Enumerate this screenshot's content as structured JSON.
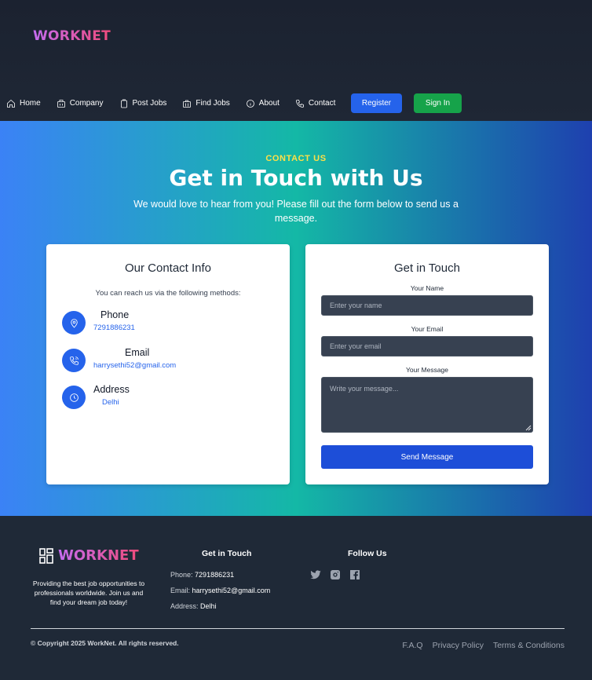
{
  "brand": {
    "name": "WORKNET",
    "gradient_from": "#c56cf0",
    "gradient_to": "#ef4b7b"
  },
  "nav": {
    "items": [
      {
        "label": "Home",
        "icon": "home-icon"
      },
      {
        "label": "Company",
        "icon": "building-icon"
      },
      {
        "label": "Post Jobs",
        "icon": "clipboard-icon"
      },
      {
        "label": "Find Jobs",
        "icon": "briefcase-icon"
      },
      {
        "label": "About",
        "icon": "info-icon"
      },
      {
        "label": "Contact",
        "icon": "phone-icon"
      }
    ],
    "register_label": "Register",
    "signin_label": "Sign In"
  },
  "hero": {
    "eyebrow": "CONTACT US",
    "title": "Get in Touch with Us",
    "subtitle": "We would love to hear from you! Please fill out the form below to send us a message."
  },
  "contact_info": {
    "title": "Our Contact Info",
    "note": "You can reach us via the following methods:",
    "items": [
      {
        "label": "Phone",
        "value": "7291886231",
        "icon": "location-pin-icon"
      },
      {
        "label": "Email",
        "value": "harrysethi52@gmail.com",
        "icon": "phone-call-icon"
      },
      {
        "label": "Address",
        "value": "Delhi",
        "icon": "clock-icon"
      }
    ]
  },
  "form": {
    "title": "Get in Touch",
    "name_label": "Your Name",
    "name_placeholder": "Enter your name",
    "email_label": "Your Email",
    "email_placeholder": "Enter your email",
    "message_label": "Your Message",
    "message_placeholder": "Write your message...",
    "submit_label": "Send Message"
  },
  "footer": {
    "brand": "WORKNET",
    "about": "Providing the best job opportunities to professionals worldwide. Join us and find your dream job today!",
    "touch_heading": "Get in Touch",
    "phone_label": "Phone:",
    "phone_value": "7291886231",
    "email_label": "Email:",
    "email_value": "harrysethi52@gmail.com",
    "address_label": "Address:",
    "address_value": "Delhi",
    "follow_heading": "Follow Us",
    "socials": [
      "twitter-icon",
      "instagram-icon",
      "facebook-icon"
    ],
    "copyright": "© Copyright 2025 WorkNet. All rights reserved.",
    "links": [
      "F.A.Q",
      "Privacy Policy",
      "Terms & Conditions"
    ]
  },
  "colors": {
    "header_bg": "#1b2230",
    "register": "#2563eb",
    "signin": "#16a34a",
    "hero_left": "#3b82f6",
    "hero_mid": "#14b8a6",
    "hero_right": "#1e40af",
    "eyebrow": "#fde047",
    "icon_circle": "#2563eb",
    "send_button": "#1d4ed8",
    "footer_bg": "#1f2937"
  }
}
